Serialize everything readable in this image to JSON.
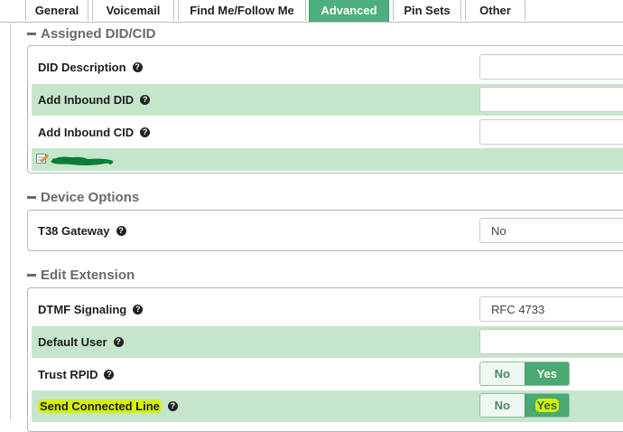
{
  "tabs": [
    {
      "label": "General"
    },
    {
      "label": "Voicemail"
    },
    {
      "label": "Find Me/Follow Me"
    },
    {
      "label": "Advanced",
      "active": true
    },
    {
      "label": "Pin Sets"
    },
    {
      "label": "Other"
    }
  ],
  "sections": {
    "assigned": {
      "title": "Assigned DID/CID",
      "rows": {
        "did_description": {
          "label": "DID Description",
          "value": ""
        },
        "add_inbound_did": {
          "label": "Add Inbound DID",
          "value": ""
        },
        "add_inbound_cid": {
          "label": "Add Inbound CID",
          "value": ""
        }
      }
    },
    "device": {
      "title": "Device Options",
      "rows": {
        "t38_gateway": {
          "label": "T38 Gateway",
          "value": "No"
        }
      }
    },
    "edit": {
      "title": "Edit Extension",
      "rows": {
        "dtmf_signaling": {
          "label": "DTMF Signaling",
          "value": "RFC 4733"
        },
        "default_user": {
          "label": "Default User",
          "value": ""
        },
        "trust_rpid": {
          "label": "Trust RPID",
          "no": "No",
          "yes": "Yes",
          "selected": "Yes"
        },
        "send_connected_line": {
          "label": "Send Connected Line",
          "no": "No",
          "yes": "Yes",
          "selected": "Yes"
        }
      }
    }
  },
  "icons": {
    "help": "question-circle-icon",
    "edit": "edit-icon"
  },
  "colors": {
    "accent": "#4caf7d",
    "alt_row": "#c6e6cc",
    "highlight": "#d4f200"
  }
}
